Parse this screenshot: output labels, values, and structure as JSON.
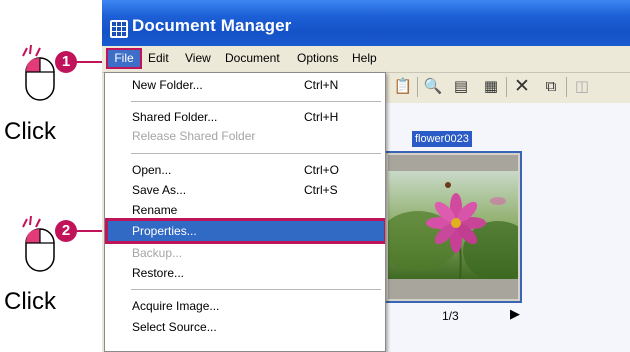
{
  "annotations": {
    "step1": {
      "number": "1",
      "label": "Click"
    },
    "step2": {
      "number": "2",
      "label": "Click"
    }
  },
  "window": {
    "title": "Document Manager",
    "icon": "document-manager-app-icon"
  },
  "menubar": {
    "items": [
      "File",
      "Edit",
      "View",
      "Document",
      "Options",
      "Help"
    ]
  },
  "file_menu": {
    "items": [
      {
        "label": "New Folder...",
        "shortcut": "Ctrl+N",
        "enabled": true
      },
      {
        "label": "Shared Folder...",
        "shortcut": "Ctrl+H",
        "enabled": true
      },
      {
        "label": "Release Shared Folder",
        "shortcut": "",
        "enabled": false
      },
      {
        "label": "Open...",
        "shortcut": "Ctrl+O",
        "enabled": true
      },
      {
        "label": "Save As...",
        "shortcut": "Ctrl+S",
        "enabled": true
      },
      {
        "label": "Rename",
        "shortcut": "",
        "enabled": true
      },
      {
        "label": "Properties...",
        "shortcut": "",
        "enabled": true,
        "highlighted": true
      },
      {
        "label": "Backup...",
        "shortcut": "",
        "enabled": false
      },
      {
        "label": "Restore...",
        "shortcut": "",
        "enabled": true
      },
      {
        "label": "Acquire Image...",
        "shortcut": "",
        "enabled": true
      },
      {
        "label": "Select Source...",
        "shortcut": "",
        "enabled": true
      }
    ]
  },
  "toolbar": {
    "icons": [
      "paste-icon",
      "search-icon",
      "properties-icon",
      "thumbnail-view-icon",
      "delete-icon",
      "copy-icon",
      "export-icon"
    ]
  },
  "content": {
    "thumbnail_name": "flower0023",
    "page_indicator": "1/3"
  },
  "colors": {
    "accent": "#c0135a",
    "menu_highlight": "#316ac5",
    "titlebar": "#1d5fd6"
  }
}
